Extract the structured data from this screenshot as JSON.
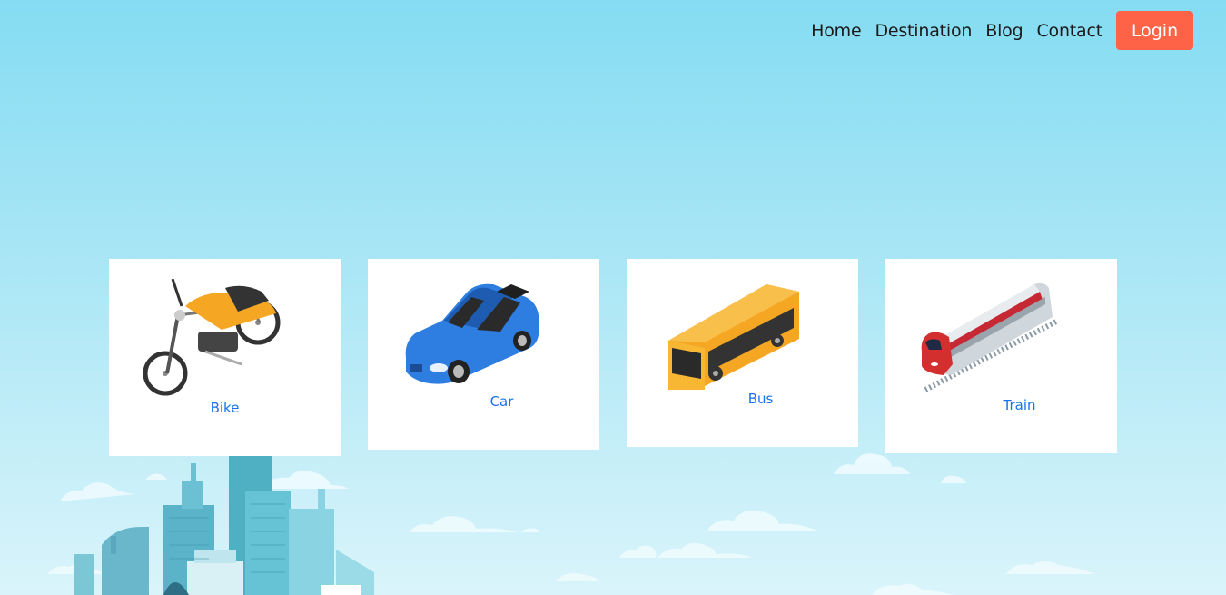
{
  "nav": {
    "links": [
      "Home",
      "Destination",
      "Blog",
      "Contact"
    ],
    "login_label": "Login"
  },
  "vehicles": [
    {
      "label": "Bike",
      "icon": "motorcycle-icon"
    },
    {
      "label": "Car",
      "icon": "car-icon"
    },
    {
      "label": "Bus",
      "icon": "bus-icon"
    },
    {
      "label": "Train",
      "icon": "train-icon"
    }
  ],
  "colors": {
    "accent": "#ff6347",
    "label": "#1a73e8",
    "sky_top": "#85dcf2",
    "sky_bottom": "#daf4fb"
  }
}
